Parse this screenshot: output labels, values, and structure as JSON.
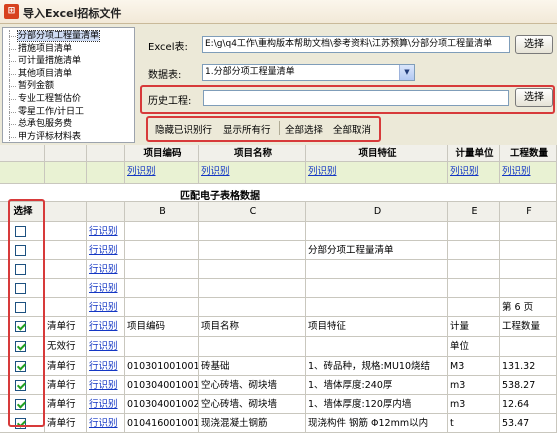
{
  "window": {
    "title": "导入Excel招标文件"
  },
  "tree": {
    "items": [
      "分部分项工程量清单",
      "措施项目清单",
      "可计量措施清单",
      "其他项目清单",
      "暂列金额",
      "专业工程暂估价",
      "零星工作/计日工",
      "总承包服务费",
      "甲方评标材料表"
    ]
  },
  "form": {
    "excel_label": "Excel表:",
    "excel_path": "E:\\g\\q4工作\\重构版本帮助文档\\参考资料\\江苏预算\\分部分项工程量清单",
    "browse_button": "选择",
    "sheet_label": "数据表:",
    "sheet_value": "1.分部分项工程量清单",
    "history_label": "历史工程:",
    "history_value": "",
    "history_button": "选择"
  },
  "toolbar": {
    "items": [
      "隐藏已识别行",
      "显示所有行",
      "全部选择",
      "全部取消"
    ]
  },
  "mapping": {
    "headers": [
      "项目编码",
      "项目名称",
      "项目特征",
      "计量单位",
      "工程数量"
    ],
    "links": [
      "列识别",
      "列识别",
      "列识别",
      "列识别",
      "列识别"
    ]
  },
  "sheet": {
    "caption": "匹配电子表格数据",
    "columns": [
      "选择",
      "",
      "",
      "B",
      "C",
      "D",
      "E",
      "F"
    ],
    "row_link": "行识别",
    "rows": [
      {
        "checked": false,
        "type": "",
        "code": "",
        "name": "",
        "feature": "",
        "unit": "",
        "qty": ""
      },
      {
        "checked": false,
        "type": "",
        "code": "",
        "name": "",
        "feature": "分部分项工程量清单",
        "unit": "",
        "qty": ""
      },
      {
        "checked": false,
        "type": "",
        "code": "",
        "name": "",
        "feature": "",
        "unit": "",
        "qty": ""
      },
      {
        "checked": false,
        "type": "",
        "code": "",
        "name": "",
        "feature": "",
        "unit": "",
        "qty": ""
      },
      {
        "checked": false,
        "type": "",
        "code": "",
        "name": "",
        "feature": "",
        "unit": "",
        "qty": "第 6 页"
      },
      {
        "checked": true,
        "type": "清单行",
        "code": "项目编码",
        "name": "项目名称",
        "feature": "项目特征",
        "unit": "计量",
        "qty": "工程数量"
      },
      {
        "checked": true,
        "type": "无效行",
        "code": "",
        "name": "",
        "feature": "",
        "unit": "单位",
        "qty": ""
      },
      {
        "checked": true,
        "type": "清单行",
        "code": "010301001001",
        "name": "砖基础",
        "feature": "1、砖品种，规格:MU10烧结",
        "unit": "M3",
        "qty": "131.32"
      },
      {
        "checked": true,
        "type": "清单行",
        "code": "010304001001",
        "name": "空心砖墙、砌块墙",
        "feature": "1、墙体厚度:240厚",
        "unit": "m3",
        "qty": "538.27"
      },
      {
        "checked": true,
        "type": "清单行",
        "code": "010304001002",
        "name": "空心砖墙、砌块墙",
        "feature": "1、墙体厚度:120厚内墙",
        "unit": "m3",
        "qty": "12.64"
      },
      {
        "checked": true,
        "type": "清单行",
        "code": "010416001001",
        "name": "现浇混凝土钢筋",
        "feature": "现浇构件 钢筋 Φ12mm以内",
        "unit": "t",
        "qty": "53.47"
      }
    ]
  }
}
